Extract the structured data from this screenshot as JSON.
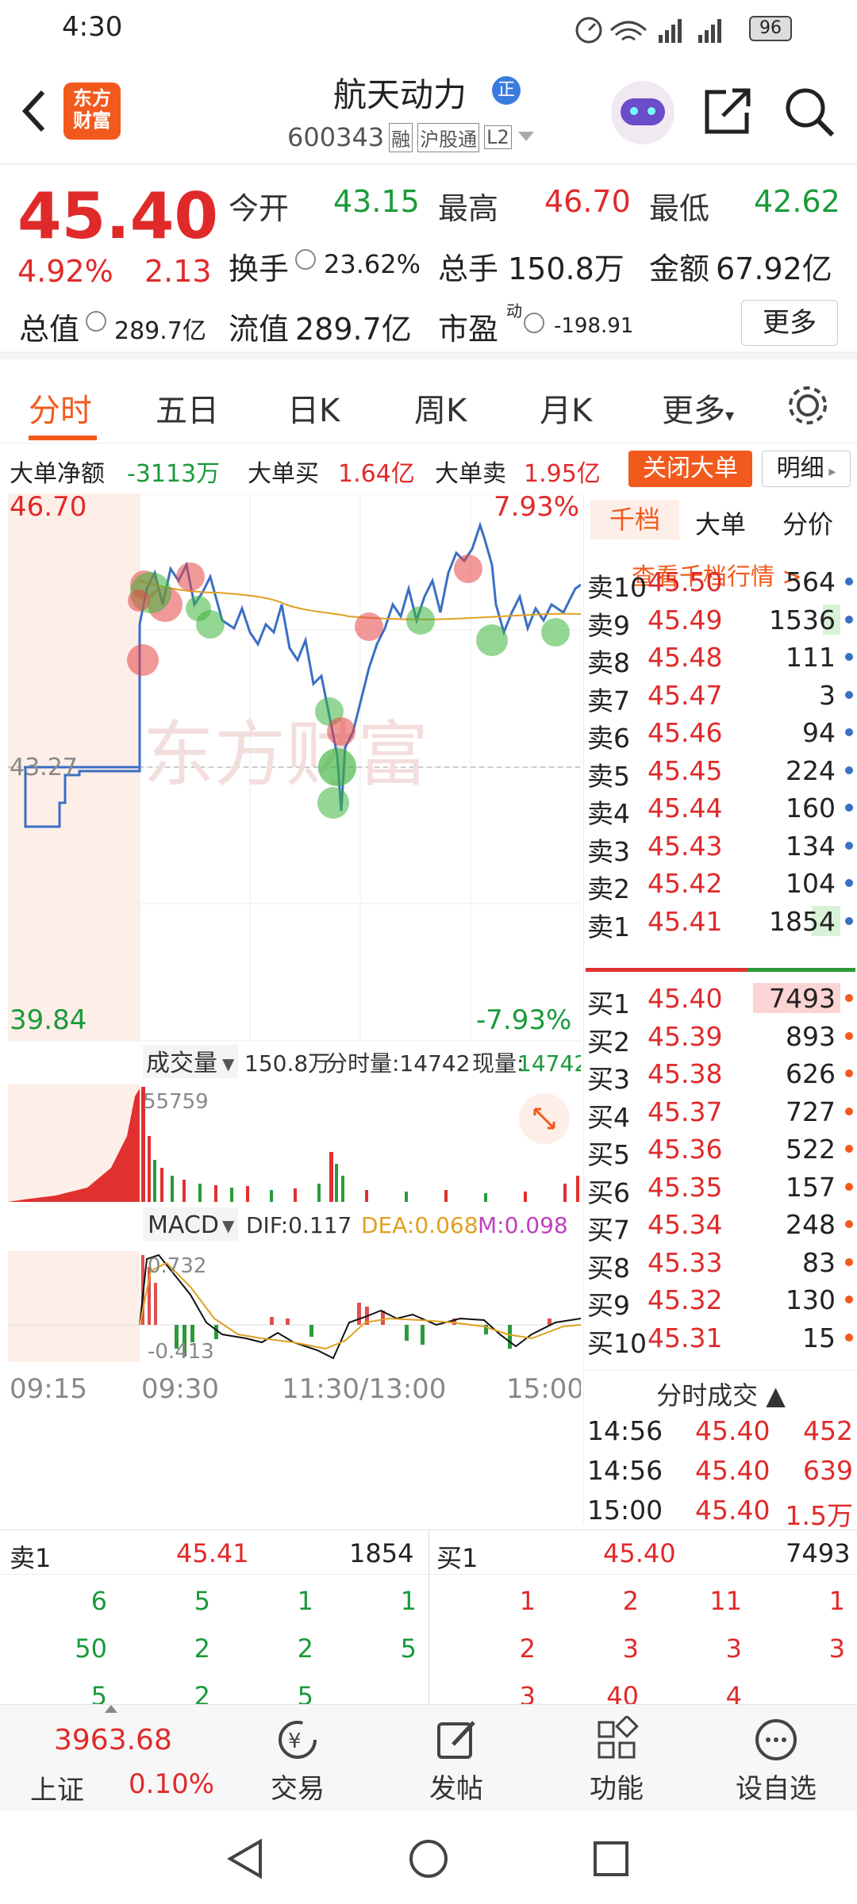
{
  "status": {
    "time": "4:30",
    "signal": "4G",
    "battery": "96"
  },
  "header": {
    "logo_top": "东方",
    "logo_bottom": "财富",
    "name": "航天动力",
    "badge": "正",
    "code": "600343",
    "tags": [
      "融",
      "沪股通",
      "L2"
    ]
  },
  "quote": {
    "price": "45.40",
    "pct": "4.92%",
    "chg": "2.13",
    "open_label": "今开",
    "open": "43.15",
    "high_label": "最高",
    "high": "46.70",
    "low_label": "最低",
    "low": "42.62",
    "turnover_label": "换手",
    "turnover": "23.62%",
    "vol_label": "总手",
    "vol": "150.8万",
    "amt_label": "金额",
    "amt": "67.92亿",
    "mcap_label": "总值",
    "mcap": "289.7亿",
    "float_label": "流值",
    "float": "289.7亿",
    "pe_label": "市盈",
    "pe_sup": "动",
    "pe": "-198.91",
    "more": "更多"
  },
  "tabs": [
    "分时",
    "五日",
    "日K",
    "周K",
    "月K",
    "更多"
  ],
  "bigorder": {
    "net_label": "大单净额",
    "net": "-3113万",
    "buy_label": "大单买",
    "buy": "1.64亿",
    "sell_label": "大单卖",
    "sell": "1.95亿",
    "close_btn": "关闭大单",
    "detail_btn": "明细"
  },
  "chart": {
    "max": "46.70",
    "min": "39.84",
    "pct_max": "7.93%",
    "pct_min": "-7.93%",
    "prev": "43.27",
    "watermark": "东方财富",
    "vol_label": "成交量",
    "vol_total": "150.8万",
    "vol_fs": "分时量:14742",
    "vol_now_label": "现量:",
    "vol_now": "14742",
    "vol_max": "55759",
    "macd_label": "MACD",
    "dif": "DIF:0.117",
    "dea": "DEA:0.068",
    "m": "M:0.098",
    "macd_max": "0.732",
    "macd_min": "-0.413",
    "times": [
      "09:15",
      "09:30",
      "11:30/13:00",
      "15:00"
    ]
  },
  "orderbook": {
    "tabs": [
      "千档",
      "大单",
      "分价"
    ],
    "link": "查看千档行情 >",
    "asks": [
      [
        "卖10",
        "45.50",
        "564"
      ],
      [
        "卖9",
        "45.49",
        "1536"
      ],
      [
        "卖8",
        "45.48",
        "111"
      ],
      [
        "卖7",
        "45.47",
        "3"
      ],
      [
        "卖6",
        "45.46",
        "94"
      ],
      [
        "卖5",
        "45.45",
        "224"
      ],
      [
        "卖4",
        "45.44",
        "160"
      ],
      [
        "卖3",
        "45.43",
        "134"
      ],
      [
        "卖2",
        "45.42",
        "104"
      ],
      [
        "卖1",
        "45.41",
        "1854"
      ]
    ],
    "bids": [
      [
        "买1",
        "45.40",
        "7493"
      ],
      [
        "买2",
        "45.39",
        "893"
      ],
      [
        "买3",
        "45.38",
        "626"
      ],
      [
        "买4",
        "45.37",
        "727"
      ],
      [
        "买5",
        "45.36",
        "522"
      ],
      [
        "买6",
        "45.35",
        "157"
      ],
      [
        "买7",
        "45.34",
        "248"
      ],
      [
        "买8",
        "45.33",
        "83"
      ],
      [
        "买9",
        "45.32",
        "130"
      ],
      [
        "买10",
        "45.31",
        "15"
      ]
    ],
    "trades_title": "分时成交",
    "trades": [
      [
        "14:56",
        "45.40",
        "452"
      ],
      [
        "14:56",
        "45.40",
        "639"
      ],
      [
        "15:00",
        "45.40",
        "1.5万"
      ]
    ]
  },
  "queue": {
    "sell_label": "卖1",
    "sell_price": "45.41",
    "sell_vol": "1854",
    "buy_label": "买1",
    "buy_price": "45.40",
    "buy_vol": "7493",
    "sell_rows": [
      [
        "6",
        "5",
        "1",
        "1"
      ],
      [
        "50",
        "2",
        "2",
        "5"
      ],
      [
        "5",
        "2",
        "5",
        ""
      ]
    ],
    "buy_rows": [
      [
        "1",
        "2",
        "11",
        "1"
      ],
      [
        "2",
        "3",
        "3",
        "3"
      ],
      [
        "3",
        "40",
        "4",
        ""
      ]
    ]
  },
  "bottom": {
    "index_val": "3963.68",
    "index_name": "上证",
    "index_pct": "0.10%",
    "items": [
      "交易",
      "发帖",
      "功能",
      "设自选"
    ]
  }
}
